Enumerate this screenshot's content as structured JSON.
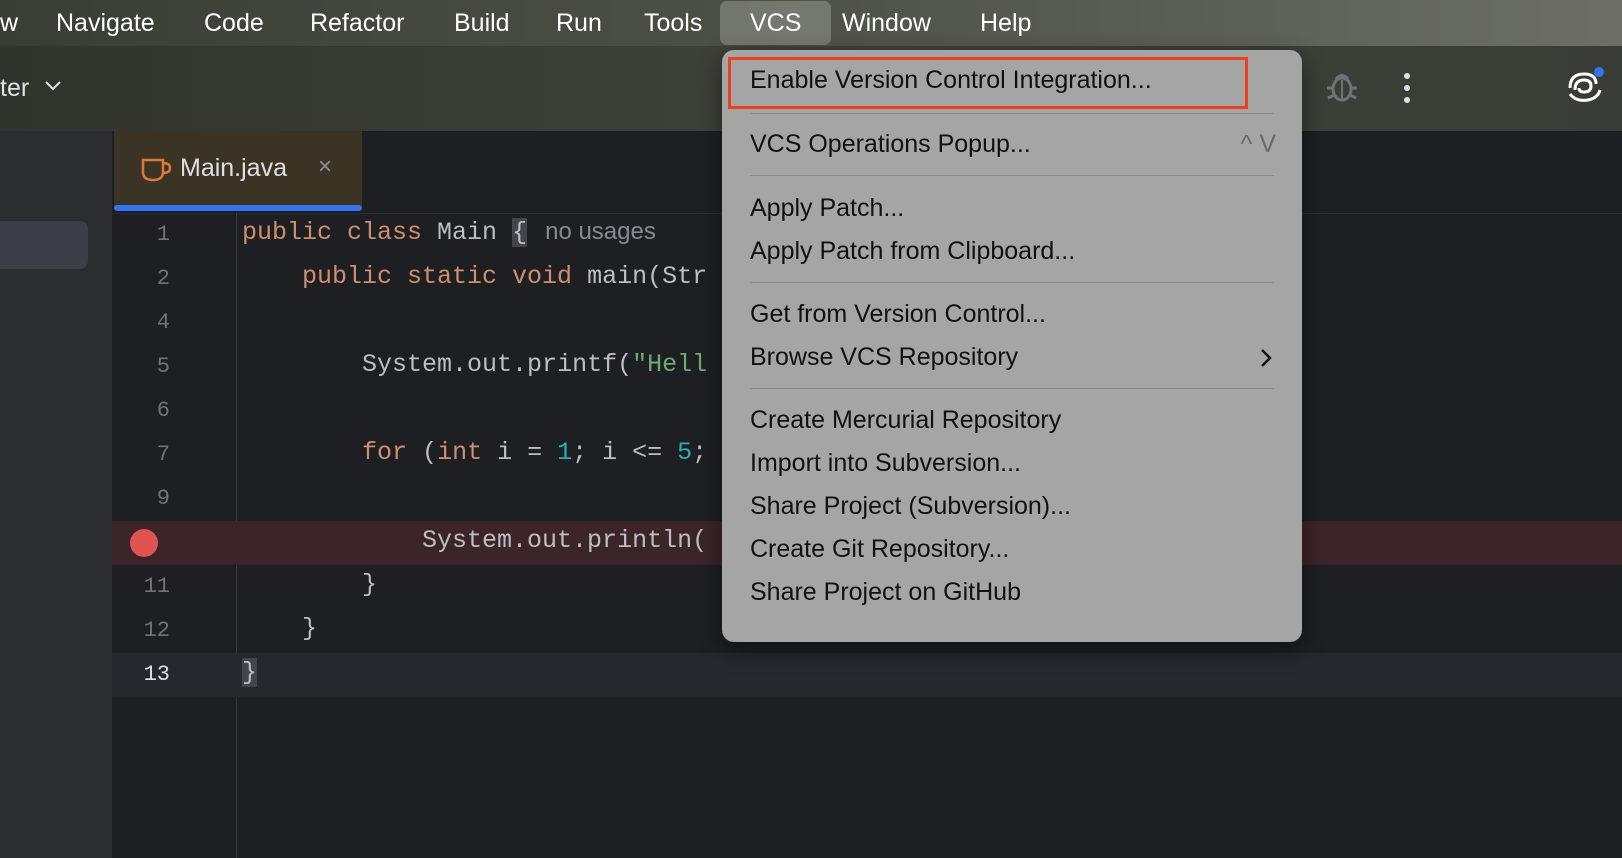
{
  "menubar": {
    "items": [
      "w",
      "Navigate",
      "Code",
      "Refactor",
      "Build",
      "Run",
      "Tools",
      "VCS",
      "Window",
      "Help"
    ],
    "active": "VCS"
  },
  "toolbar": {
    "project_label": "ter",
    "icons": [
      "chevron-down-icon",
      "debug-icon",
      "more-options-icon",
      "ai-assistant-icon"
    ]
  },
  "editor": {
    "tab": {
      "label": "Main.java",
      "close": "×",
      "icon": "java-cup-icon"
    },
    "lines": [
      {
        "num": "1"
      },
      {
        "num": "2"
      },
      {
        "num": "4"
      },
      {
        "num": "5"
      },
      {
        "num": "6"
      },
      {
        "num": "7"
      },
      {
        "num": "9"
      },
      {
        "num": "",
        "breakpoint": true
      },
      {
        "num": "11"
      },
      {
        "num": "12"
      },
      {
        "num": "13"
      }
    ],
    "code": {
      "l1_kw": "public class",
      "l1_name": "Main",
      "l1_brace": "{",
      "l1_hint": "no usages",
      "l2_kw": "public static void",
      "l2_rest": "main(Str",
      "l5_a": "System.out.printf(",
      "l5_str": "\"Hell",
      "l7_kw1": "for",
      "l7_a": " (",
      "l7_kw2": "int",
      "l7_b": " i = ",
      "l7_n1": "1",
      "l7_c": "; i <= ",
      "l7_n2": "5",
      "l7_d": ";",
      "l10": "System.out.println(",
      "l11": "}",
      "l12": "}",
      "l13": "}"
    }
  },
  "vcs_menu": {
    "items": [
      {
        "label": "Enable Version Control Integration...",
        "highlighted": true
      },
      {
        "label": "VCS Operations Popup...",
        "shortcut": "^ V"
      },
      {
        "label": "Apply Patch..."
      },
      {
        "label": "Apply Patch from Clipboard..."
      },
      {
        "label": "Get from Version Control..."
      },
      {
        "label": "Browse VCS Repository",
        "submenu": true
      },
      {
        "label": "Create Mercurial Repository"
      },
      {
        "label": "Import into Subversion..."
      },
      {
        "label": "Share Project (Subversion)..."
      },
      {
        "label": "Create Git Repository..."
      },
      {
        "label": "Share Project on GitHub"
      }
    ],
    "highlight_color": "#e8411c"
  }
}
